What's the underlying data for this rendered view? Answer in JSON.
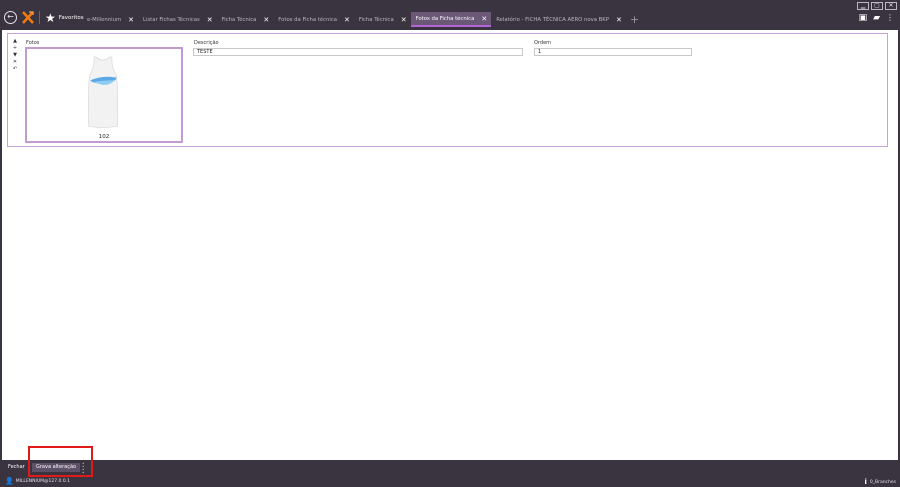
{
  "window": {
    "controls": [
      "▁",
      "▢",
      "✕"
    ]
  },
  "nav": {
    "favorites_label": "Favoritos",
    "back_icon": "back-arrow-icon",
    "logo_icon": "x-logo-icon"
  },
  "tabs": [
    {
      "label": "e-Millennium",
      "active": false
    },
    {
      "label": "Listar Fichas Técnicas",
      "active": false
    },
    {
      "label": "Ficha Técnica",
      "active": false
    },
    {
      "label": "Fotos da Ficha técnica",
      "active": false
    },
    {
      "label": "Ficha Técnica",
      "active": false
    },
    {
      "label": "Fotos da Ficha técnica",
      "active": true
    },
    {
      "label": "Relatório - FICHA TÉCNICA AERO nova BKP",
      "active": false
    }
  ],
  "form": {
    "photos_label": "Fotos",
    "photo_number": "102",
    "description_label": "Descrição",
    "description_value": "TESTE",
    "order_label": "Ordem",
    "order_value": "1"
  },
  "bottom": {
    "close_label": "Fechar",
    "save_label": "Grava alteração",
    "user_label": "MILLENNIUM@127.0.0.1",
    "branch_label": "0_Branches"
  },
  "colors": {
    "chrome": "#3a3340",
    "active_tab": "#6b5877",
    "accent": "#b565d6",
    "panel_border": "#c9a2d8",
    "highlight": "#e01919"
  }
}
